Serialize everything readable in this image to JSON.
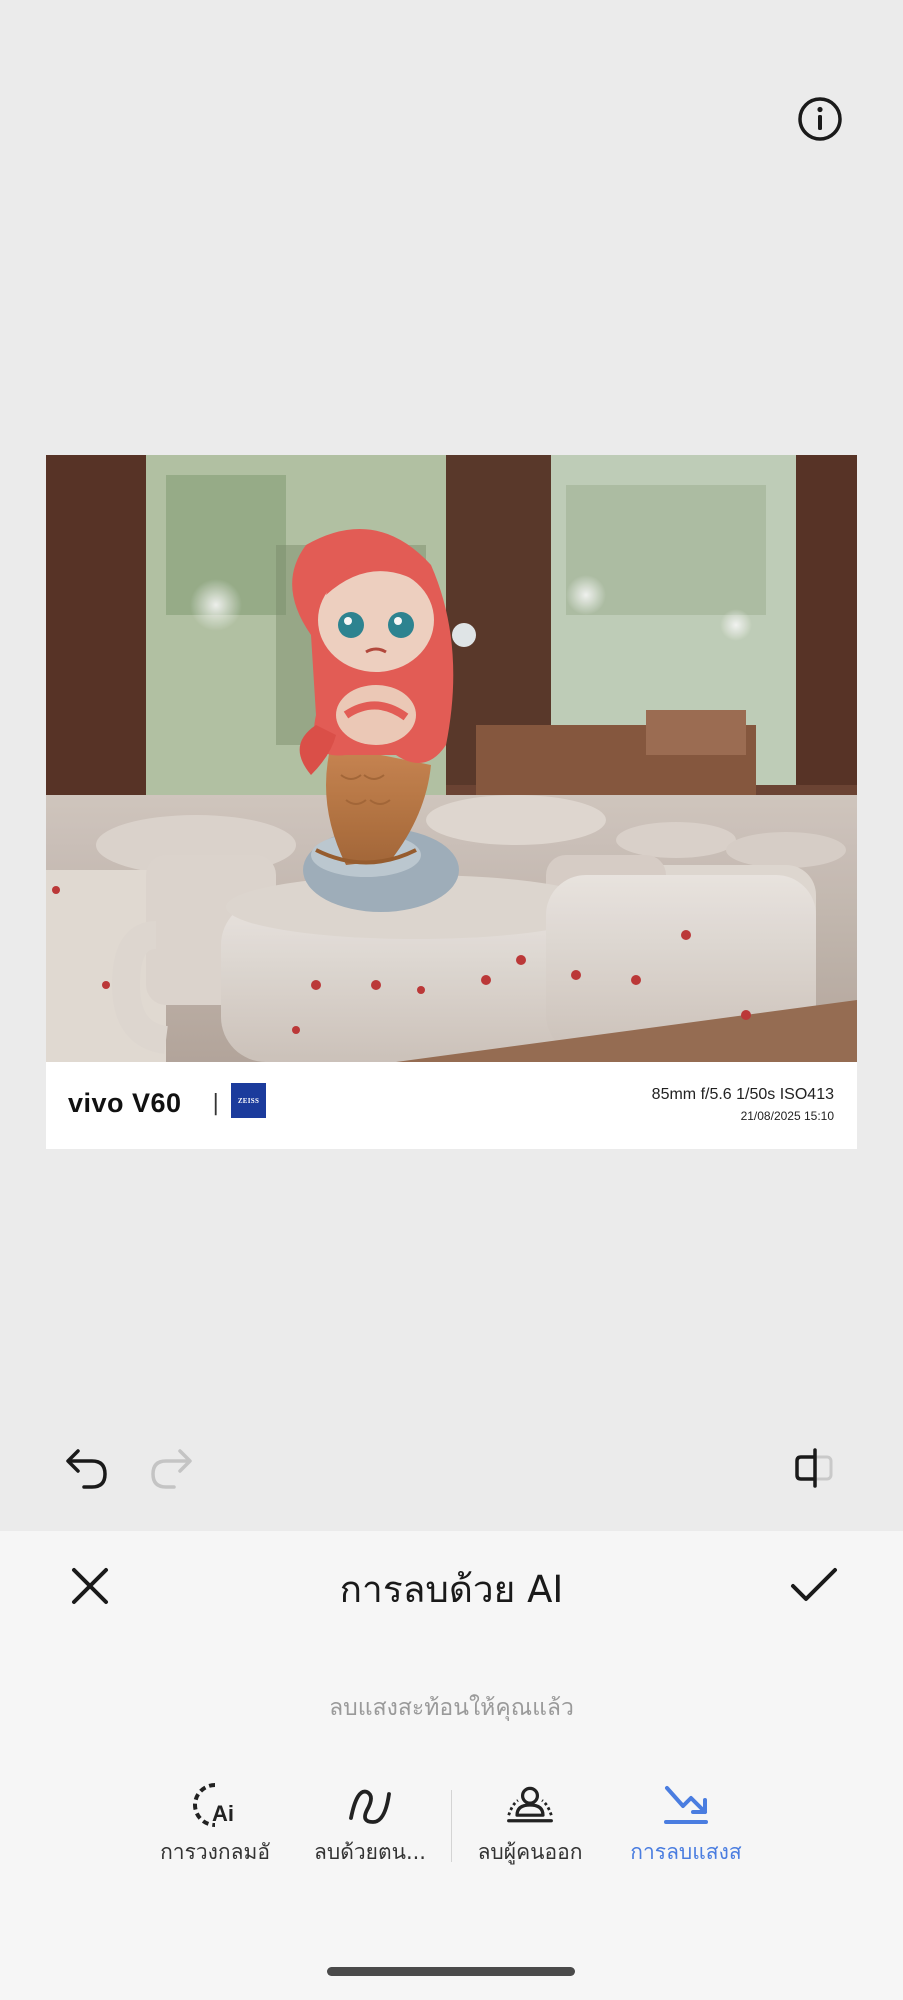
{
  "photo": {
    "watermark": {
      "brand": "vivo V60",
      "separator": "|",
      "logo_text": "ZEISS",
      "params": "85mm  f/5.6  1/50s  ISO413",
      "datetime": "21/08/2025 15:10"
    }
  },
  "editor": {
    "title": "การลบด้วย AI",
    "status_message": "ลบแสงสะท้อนให้คุณแล้ว",
    "tabs": [
      {
        "label": "การวงกลมอั",
        "icon": "ai-circle-icon",
        "active": false
      },
      {
        "label": "ลบด้วยตน...",
        "icon": "brush-stroke-icon",
        "active": false
      },
      {
        "label": "ลบผู้คนออก",
        "icon": "remove-people-icon",
        "active": false
      },
      {
        "label": "การลบแสงส",
        "icon": "remove-reflection-icon",
        "active": true
      }
    ]
  },
  "colors": {
    "accent": "#4a7de0",
    "background": "#ebebeb",
    "panel": "#f6f6f6"
  }
}
